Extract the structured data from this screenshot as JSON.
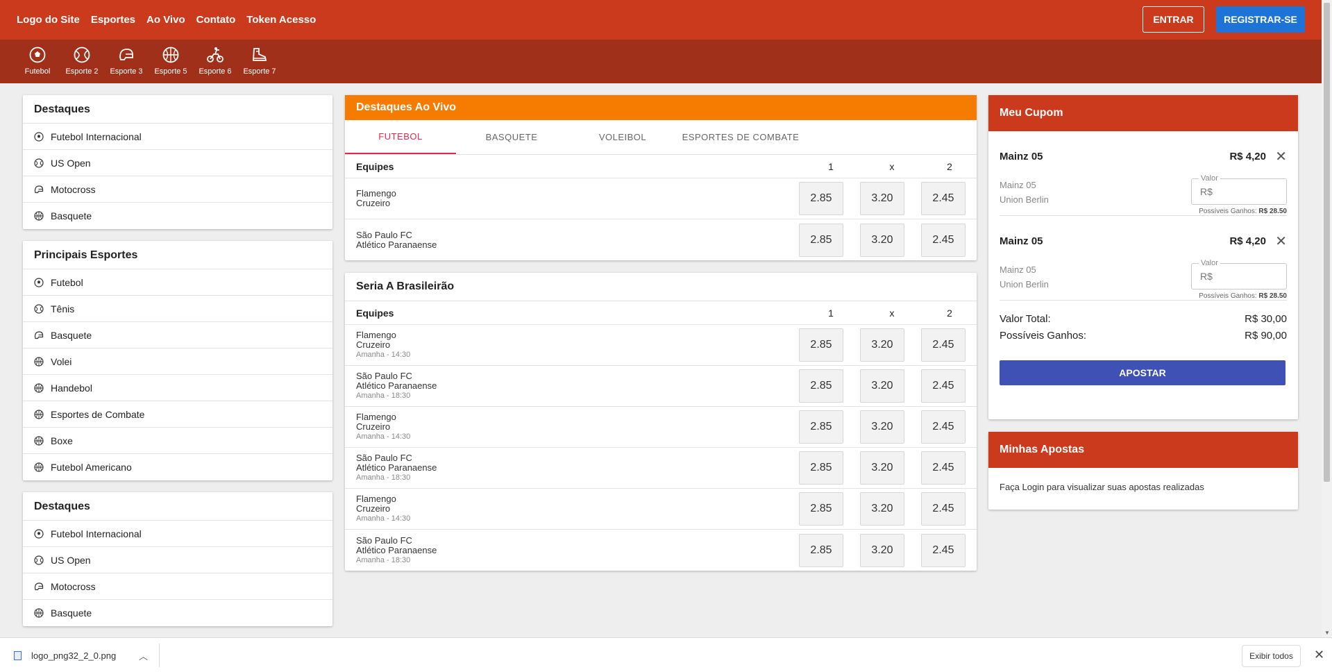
{
  "nav": {
    "links": [
      "Logo do Site",
      "Esportes",
      "Ao Vivo",
      "Contato",
      "Token Acesso"
    ],
    "login_label": "ENTRAR",
    "register_label": "REGISTRAR-SE"
  },
  "sports_bar": [
    {
      "label": "Futebol",
      "icon": "soccer-ball-icon"
    },
    {
      "label": "Esporte 2",
      "icon": "tennis-ball-icon"
    },
    {
      "label": "Esporte 3",
      "icon": "helmet-icon"
    },
    {
      "label": "Esporte 5",
      "icon": "basketball-icon"
    },
    {
      "label": "Esporte 6",
      "icon": "motocross-icon"
    },
    {
      "label": "Esporte 7",
      "icon": "sneaker-icon"
    }
  ],
  "sidebar": {
    "destaques_title": "Destaques",
    "destaques": [
      {
        "label": "Futebol Internacional",
        "icon": "soccer-ball-icon"
      },
      {
        "label": "US Open",
        "icon": "tennis-ball-icon"
      },
      {
        "label": "Motocross",
        "icon": "helmet-icon"
      },
      {
        "label": "Basquete",
        "icon": "basketball-icon"
      }
    ],
    "principais_title": "Principais Esportes",
    "principais": [
      {
        "label": "Futebol",
        "icon": "soccer-ball-icon"
      },
      {
        "label": "Tênis",
        "icon": "tennis-ball-icon"
      },
      {
        "label": "Basquete",
        "icon": "helmet-icon"
      },
      {
        "label": "Volei",
        "icon": "basketball-icon"
      },
      {
        "label": "Handebol",
        "icon": "basketball-icon"
      },
      {
        "label": "Esportes de Combate",
        "icon": "basketball-icon"
      },
      {
        "label": "Boxe",
        "icon": "basketball-icon"
      },
      {
        "label": "Futebol Americano",
        "icon": "basketball-icon"
      }
    ],
    "destaques2_title": "Destaques",
    "destaques2": [
      {
        "label": "Futebol Internacional",
        "icon": "soccer-ball-icon"
      },
      {
        "label": "US Open",
        "icon": "tennis-ball-icon"
      },
      {
        "label": "Motocross",
        "icon": "helmet-icon"
      },
      {
        "label": "Basquete",
        "icon": "basketball-icon"
      }
    ]
  },
  "live": {
    "title": "Destaques Ao Vivo",
    "tabs": [
      "FUTEBOL",
      "BASQUETE",
      "VOLEIBOL",
      "ESPORTES DE COMBATE"
    ],
    "active_tab": 0,
    "columns": {
      "teams": "Equipes",
      "c1": "1",
      "cx": "x",
      "c2": "2"
    },
    "matches": [
      {
        "home": "Flamengo",
        "away": "Cruzeiro",
        "odds": [
          "2.85",
          "3.20",
          "2.45"
        ]
      },
      {
        "home": "São Paulo FC",
        "away": "Atlético Paranaense",
        "odds": [
          "2.85",
          "3.20",
          "2.45"
        ]
      }
    ]
  },
  "league": {
    "title": "Seria A Brasileirão",
    "columns": {
      "teams": "Equipes",
      "c1": "1",
      "cx": "x",
      "c2": "2"
    },
    "matches": [
      {
        "home": "Flamengo",
        "away": "Cruzeiro",
        "time": "Amanha - 14:30",
        "odds": [
          "2.85",
          "3.20",
          "2.45"
        ]
      },
      {
        "home": "São Paulo FC",
        "away": "Atlético Paranaense",
        "time": "Amanha - 18:30",
        "odds": [
          "2.85",
          "3.20",
          "2.45"
        ]
      },
      {
        "home": "Flamengo",
        "away": "Cruzeiro",
        "time": "Amanha - 14:30",
        "odds": [
          "2.85",
          "3.20",
          "2.45"
        ]
      },
      {
        "home": "São Paulo FC",
        "away": "Atlético Paranaense",
        "time": "Amanha - 18:30",
        "odds": [
          "2.85",
          "3.20",
          "2.45"
        ]
      },
      {
        "home": "Flamengo",
        "away": "Cruzeiro",
        "time": "Amanha - 14:30",
        "odds": [
          "2.85",
          "3.20",
          "2.45"
        ]
      },
      {
        "home": "São Paulo FC",
        "away": "Atlético Paranaense",
        "time": "Amanha - 18:30",
        "odds": [
          "2.85",
          "3.20",
          "2.45"
        ]
      }
    ]
  },
  "coupon": {
    "title": "Meu Cupom",
    "bets": [
      {
        "name": "Mainz 05",
        "price": "R$ 4,20",
        "team1": "Mainz 05",
        "team2": "Union Berlin",
        "field_label": "Valor",
        "field_placeholder": "R$",
        "gain_label": "Possíveis Ganhos:",
        "gain_value": "R$ 28.50"
      },
      {
        "name": "Mainz 05",
        "price": "R$ 4,20",
        "team1": "Mainz 05",
        "team2": "Union Berlin",
        "field_label": "Valor",
        "field_placeholder": "R$",
        "gain_label": "Possíveis Ganhos:",
        "gain_value": "R$ 28.50"
      }
    ],
    "total_label": "Valor Total:",
    "total_value": "R$ 30,00",
    "gains_label": "Possíveis Ganhos:",
    "gains_value": "R$ 90,00",
    "submit_label": "APOSTAR"
  },
  "my_bets": {
    "title": "Minhas Apostas",
    "text": "Faça Login para visualizar suas apostas realizadas"
  },
  "downloads": {
    "file_name": "logo_png32_2_0.png",
    "show_all_label": "Exibir todos",
    "close_glyph": "✕"
  },
  "colors": {
    "topbar": "#cc3a1d",
    "sportbar": "#a0301a",
    "live_header": "#f57c00",
    "register_button": "#1e74d6",
    "submit_button": "#3f51b5",
    "active_tab": "#e0284c"
  }
}
